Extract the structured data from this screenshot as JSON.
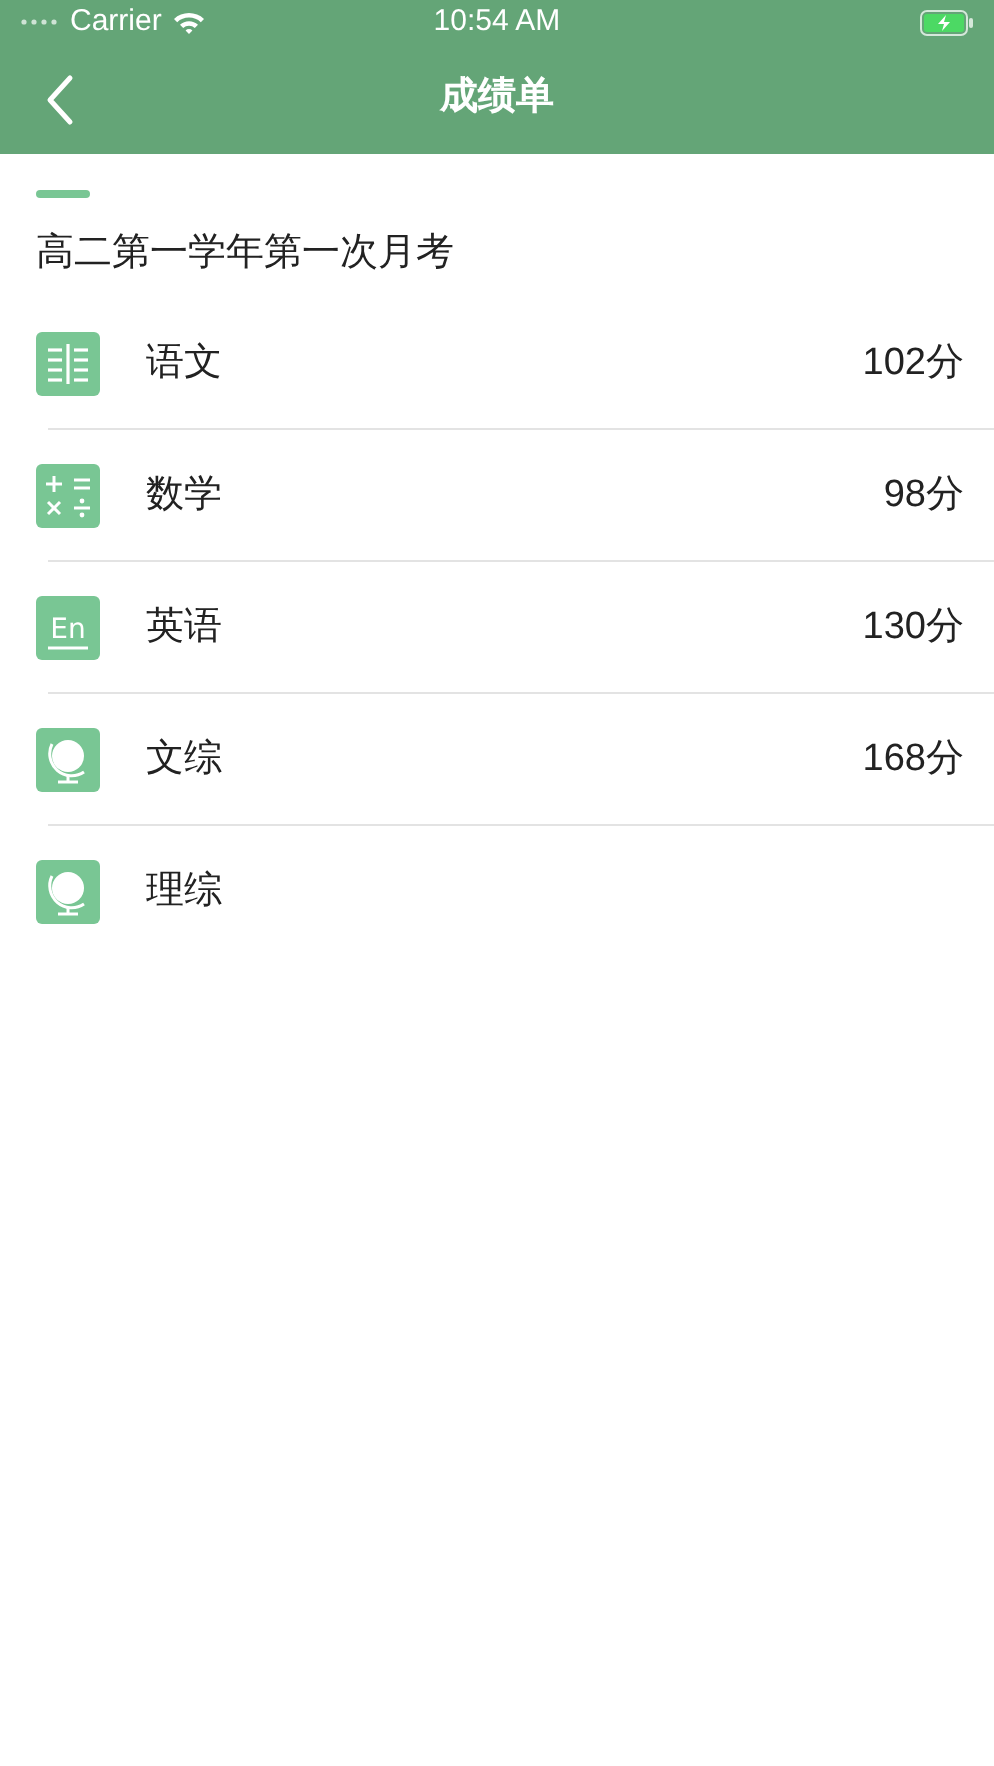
{
  "status_bar": {
    "carrier": "Carrier",
    "time": "10:54 AM",
    "charging": true
  },
  "nav_bar": {
    "title": "成绩单"
  },
  "exam": {
    "title": "高二第一学年第一次月考"
  },
  "subjects": [
    {
      "name": "语文",
      "score": "102分",
      "kind": "book"
    },
    {
      "name": "数学",
      "score": "98分",
      "kind": "math"
    },
    {
      "name": "英语",
      "score": "130分",
      "kind": "letters",
      "icon_text": "En"
    },
    {
      "name": "文综",
      "score": "168分",
      "kind": "globe"
    },
    {
      "name": "理综",
      "kind": "globe"
    }
  ]
}
